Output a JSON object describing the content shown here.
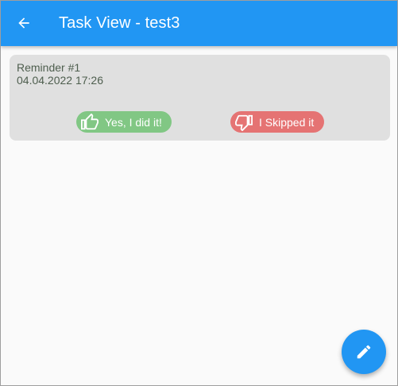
{
  "appbar": {
    "title": "Task View - test3",
    "back_icon": "arrow-back-icon",
    "color": "#2196f3"
  },
  "reminders": [
    {
      "title": "Reminder #1",
      "datetime": "04.04.2022 17:26",
      "done_label": "Yes, I did it!",
      "done_icon": "thumb-up-icon",
      "skip_label": "I Skipped it",
      "skip_icon": "thumb-down-icon"
    }
  ],
  "colors": {
    "done_chip": "#81c784",
    "skip_chip": "#e57373",
    "card": "#e0e0e0"
  },
  "fab": {
    "icon": "edit-pencil-icon"
  }
}
